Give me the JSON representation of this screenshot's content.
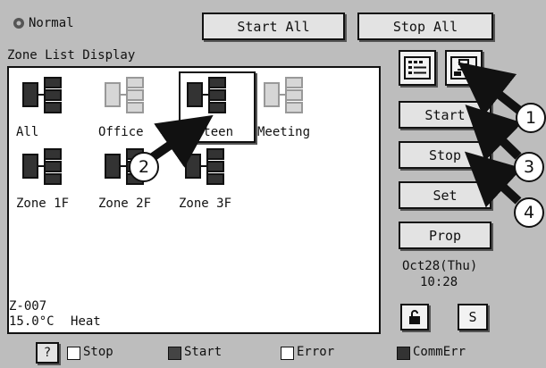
{
  "header": {
    "mode_label": "Normal",
    "start_all": "Start All",
    "stop_all": "Stop All"
  },
  "panel_title": "Zone List Display",
  "zones": [
    {
      "label": "All",
      "state": "start"
    },
    {
      "label": "Office",
      "state": "stop"
    },
    {
      "label": "Canteen",
      "state": "start"
    },
    {
      "label": "Meeting",
      "state": "stop"
    },
    {
      "label": "Zone 1F",
      "state": "start"
    },
    {
      "label": "Zone 2F",
      "state": "start"
    },
    {
      "label": "Zone 3F",
      "state": "start"
    }
  ],
  "status": {
    "zone_id": "Z-007",
    "temperature": "15.0°C",
    "mode": "Heat"
  },
  "side_buttons": {
    "start": "Start",
    "stop": "Stop",
    "set": "Set",
    "prop": "Prop",
    "s": "S"
  },
  "clock": {
    "date": "Oct28(Thu)",
    "time": "10:28"
  },
  "legend": {
    "help": "?",
    "stop": "Stop",
    "start": "Start",
    "error": "Error",
    "commerr": "CommErr"
  },
  "callouts": [
    "1",
    "2",
    "3",
    "4"
  ],
  "colors": {
    "background": "#bdbdbd",
    "start": "#444444",
    "stop": "#ffffff",
    "error": "#ffffff",
    "commerr": "#333333",
    "zone_icon_stop": "#d6d6d6"
  }
}
